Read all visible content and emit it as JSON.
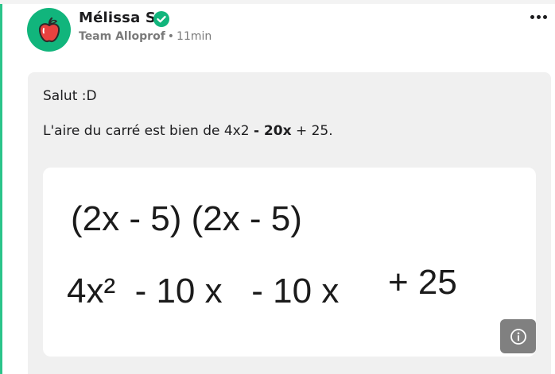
{
  "post": {
    "author": {
      "name": "Mélissa S",
      "verified_icon": "check-circle-icon",
      "avatar_icon": "apple-icon"
    },
    "meta": {
      "team": "Team Alloprof",
      "separator": "•",
      "time": "11min"
    },
    "more_icon": "more-horizontal-icon",
    "body": {
      "greeting": "Salut :D",
      "line": {
        "prefix": "L'aire du carré est bien de 4x2 ",
        "bold": "- 20x",
        "suffix": " + 25."
      }
    },
    "image": {
      "line1": "(2x - 5) (2x - 5)",
      "line2": "4x²  - 10 x   - 10 x",
      "line2_end": "+ 25",
      "info_icon": "info-icon"
    }
  },
  "colors": {
    "accent": "#11b57c",
    "left_rule": "#2bc48a",
    "content_bg": "#f0f0f0",
    "info_button": "#808080"
  }
}
